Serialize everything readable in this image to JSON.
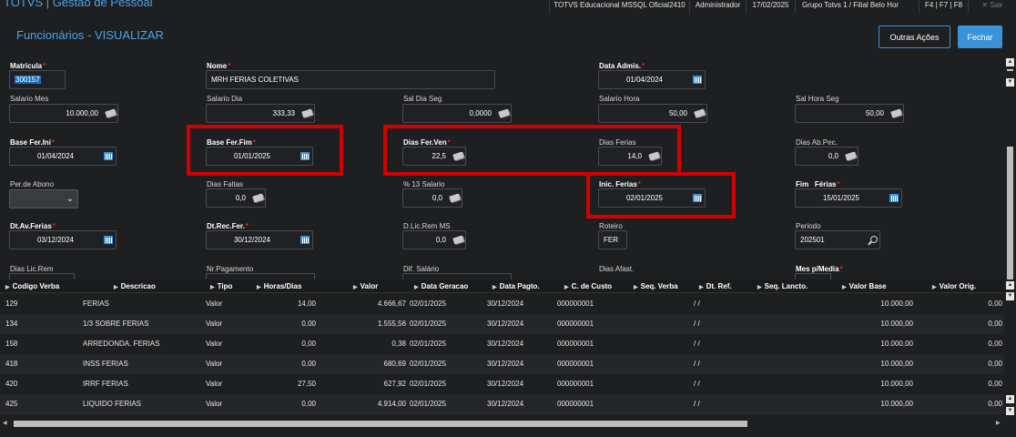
{
  "app": {
    "title": "TOTVS | Gestão de Pessoal"
  },
  "topinfo": {
    "company": "TOTVS Educacional MSSQL Oficial2410",
    "user": "Administrador",
    "date": "17/02/2025",
    "branch": "Grupo Totvs 1 / Filial Belo Hor",
    "shortcuts": "F4 | F7 | F8",
    "exit": "Sair"
  },
  "page": {
    "title": "Funcionários - VISUALIZAR"
  },
  "buttons": {
    "other_actions": "Outras Ações",
    "close": "Fechar"
  },
  "form": {
    "matricula": {
      "label": "Matricula",
      "value": "300157"
    },
    "nome": {
      "label": "Nome",
      "value": "MRH FERIAS COLETIVAS"
    },
    "data_admis": {
      "label": "Data Admis.",
      "value": "01/04/2024"
    },
    "salario_mes": {
      "label": "Salario Mes",
      "value": "10.000,00"
    },
    "salario_dia": {
      "label": "Salario Dia",
      "value": "333,33"
    },
    "sal_dia_seg": {
      "label": "Sal Dia Seg",
      "value": "0,0000"
    },
    "salario_hora": {
      "label": "Salario Hora",
      "value": "50,00"
    },
    "sal_hora_seg": {
      "label": "Sal Hora Seg",
      "value": "50,00"
    },
    "base_fer_ini": {
      "label": "Base Fer.Ini",
      "value": "01/04/2024"
    },
    "base_fer_fim": {
      "label": "Base Fer.Fim",
      "value": "01/01/2025"
    },
    "dias_fer_ven": {
      "label": "Dias Fer.Ven",
      "value": "22,5"
    },
    "dias_ferias": {
      "label": "Dias Ferias",
      "value": "14,0"
    },
    "dias_ab_pec": {
      "label": "Dias Ab.Pec.",
      "value": "0,0"
    },
    "per_abono": {
      "label": "Per.de Abono",
      "value": ""
    },
    "dias_faltas": {
      "label": "Dias Faltas",
      "value": "0,0"
    },
    "pct_13_salario": {
      "label": "% 13 Salario",
      "value": "0,0"
    },
    "inic_ferias": {
      "label": "Inic. Ferias",
      "value": "02/01/2025"
    },
    "fim_ferias": {
      "label": "Fim   Férias",
      "value": "15/01/2025"
    },
    "dt_av_ferias": {
      "label": "Dt.Av.Ferias",
      "value": "03/12/2024"
    },
    "dt_rec_fer": {
      "label": "Dt.Rec.Fer.",
      "value": "30/12/2024"
    },
    "d_lic_rem_ms": {
      "label": "D.Lic.Rem MS",
      "value": "0,0"
    },
    "roteiro": {
      "label": "Roteiro",
      "value": "FER"
    },
    "periodo": {
      "label": "Periodo",
      "value": "202501"
    },
    "dias_lic_rem": {
      "label": "Dias Lic.Rem"
    },
    "nr_pagamento": {
      "label": "Nr.Pagamento"
    },
    "dif_salario": {
      "label": "Dif. Salário"
    },
    "dias_afast": {
      "label": "Dias Afast."
    },
    "mes_p_media": {
      "label": "Mes p/Media"
    }
  },
  "table": {
    "columns": [
      "Codigo Verba",
      "Descricao",
      "Tipo",
      "Horas/Dias",
      "Valor",
      "Data Geracao",
      "Data Pagto.",
      "C. de Custo",
      "Seq. Verba",
      "Dt. Ref.",
      "Seq. Lancto.",
      "Valor Base",
      "Valor Orig."
    ],
    "rows": [
      [
        "129",
        "FERIAS",
        "Valor",
        "14,00",
        "4.666,67",
        "02/01/2025",
        "30/12/2024",
        "000000001",
        "",
        "/ /",
        "",
        "10.000,00",
        "0,00"
      ],
      [
        "134",
        "1/3 SOBRE FERIAS",
        "Valor",
        "0,00",
        "1.555,56",
        "02/01/2025",
        "30/12/2024",
        "000000001",
        "",
        "/ /",
        "",
        "10.000,00",
        "0,00"
      ],
      [
        "158",
        "ARREDONDA. FERIAS",
        "Valor",
        "0,00",
        "0,38",
        "02/01/2025",
        "30/12/2024",
        "000000001",
        "",
        "/ /",
        "",
        "10.000,00",
        "0,00"
      ],
      [
        "418",
        "INSS FERIAS",
        "Valor",
        "0,00",
        "680,69",
        "02/01/2025",
        "30/12/2024",
        "000000001",
        "",
        "/ /",
        "",
        "10.000,00",
        "0,00"
      ],
      [
        "420",
        "IRRF FERIAS",
        "Valor",
        "27,50",
        "627,92",
        "02/01/2025",
        "30/12/2024",
        "000000001",
        "",
        "/ /",
        "",
        "10.000,00",
        "0,00"
      ],
      [
        "425",
        "LIQUIDO FERIAS",
        "Valor",
        "0,00",
        "4.914,00",
        "02/01/2025",
        "30/12/2024",
        "000000001",
        "",
        "/ /",
        "",
        "10.000,00",
        "0,00"
      ]
    ]
  },
  "icons": {
    "calendar": "calendar-icon",
    "money": "money-icon",
    "search": "search-icon",
    "dropdown": "chevron-down-icon"
  },
  "colors": {
    "accent": "#3a92d8",
    "title": "#4da3e6",
    "highlight": "#d40000",
    "required": "#e02424"
  }
}
